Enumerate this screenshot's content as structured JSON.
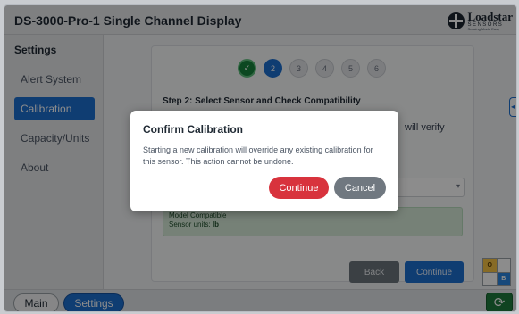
{
  "header": {
    "title": "DS-3000-Pro-1 Single Channel Display",
    "logo": {
      "brand": "Loadstar",
      "sub": "SENSORS",
      "tagline": "Sensing Made Easy"
    }
  },
  "sidebar": {
    "heading": "Settings",
    "items": [
      {
        "label": "Alert System",
        "active": false
      },
      {
        "label": "Calibration",
        "active": true
      },
      {
        "label": "Capacity/Units",
        "active": false
      },
      {
        "label": "About",
        "active": false
      }
    ]
  },
  "wizard": {
    "steps": [
      "✓",
      "2",
      "3",
      "4",
      "5",
      "6"
    ],
    "current_step": 2,
    "step_title": "Step 2: Select Sensor and Check Compatibility",
    "partial_text": "will verify",
    "compat_line1": "Model Compatible",
    "compat_units_label": "Sensor units:",
    "compat_units_value": "lb",
    "back_label": "Back",
    "continue_label": "Continue"
  },
  "footer": {
    "main_label": "Main",
    "settings_label": "Settings",
    "refresh_icon": "⟳"
  },
  "status_grid": [
    "O",
    "",
    "",
    "B"
  ],
  "modal": {
    "title": "Confirm Calibration",
    "body": "Starting a new calibration will override any existing calibration for this sensor. This action cannot be undone.",
    "continue_label": "Continue",
    "cancel_label": "Cancel"
  },
  "colors": {
    "primary": "#1d6fd0",
    "danger": "#d8333d",
    "secondary": "#707880",
    "success": "#17843c"
  }
}
